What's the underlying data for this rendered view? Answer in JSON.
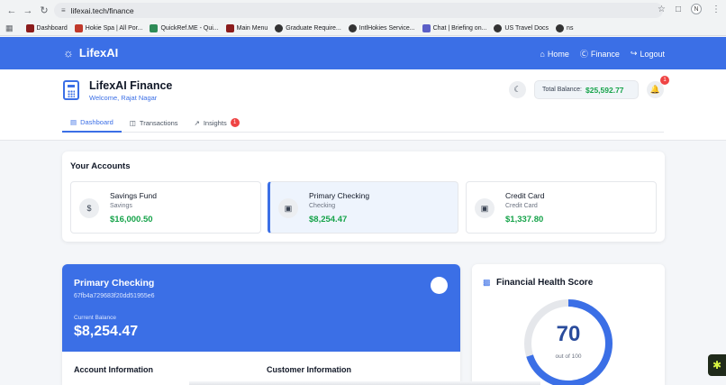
{
  "browser": {
    "url": "lifexai.tech/finance",
    "profile_initial": "N",
    "bookmarks": [
      {
        "label": "Dashboard",
        "color": "#8b1c1c"
      },
      {
        "label": "Hokie Spa | All Por...",
        "color": "#c0392b"
      },
      {
        "label": "QuickRef.ME - Qui...",
        "color": "#2e8b57"
      },
      {
        "label": "Main Menu",
        "color": "#8b1c1c"
      },
      {
        "label": "Graduate Require...",
        "color": "#333333"
      },
      {
        "label": "IntlHokies Service...",
        "color": "#333333"
      },
      {
        "label": "Chat | Briefing on...",
        "color": "#5b5fc7"
      },
      {
        "label": "US Travel Docs",
        "color": "#333333"
      },
      {
        "label": "ns",
        "color": "#333333"
      }
    ]
  },
  "header": {
    "brand": "LifexAI",
    "links": [
      {
        "label": "Home",
        "icon": "home-icon"
      },
      {
        "label": "Finance",
        "icon": "dollar-circle-icon"
      },
      {
        "label": "Logout",
        "icon": "logout-icon"
      }
    ]
  },
  "subheader": {
    "title": "LifexAI Finance",
    "welcome": "Welcome, Rajat Nagar",
    "balance_label": "Total Balance:",
    "balance_value": "$25,592.77",
    "notification_count": "1"
  },
  "tabs": [
    {
      "label": "Dashboard",
      "active": true
    },
    {
      "label": "Transactions",
      "active": false
    },
    {
      "label": "Insights",
      "active": false,
      "badge": "1"
    }
  ],
  "accounts": {
    "title": "Your Accounts",
    "items": [
      {
        "name": "Savings Fund",
        "type": "Savings",
        "balance": "$16,000.50",
        "icon": "dollar-icon"
      },
      {
        "name": "Primary Checking",
        "type": "Checking",
        "balance": "$8,254.47",
        "icon": "card-icon",
        "selected": true
      },
      {
        "name": "Credit Card",
        "type": "Credit Card",
        "balance": "$1,337.80",
        "icon": "card-icon"
      }
    ]
  },
  "primary_card": {
    "title": "Primary Checking",
    "account_id": "67fb4a729683f20dd51955e6",
    "current_label": "Current Balance",
    "current_value": "$8,254.47",
    "account_info_heading": "Account Information",
    "customer_info_heading": "Customer Information"
  },
  "financial_health": {
    "title": "Financial Health Score",
    "score": 70,
    "score_text": "70",
    "out_of": "out of 100"
  },
  "colors": {
    "accent": "#3b6fe6",
    "positive": "#16a34a",
    "badge": "#ef4444"
  }
}
